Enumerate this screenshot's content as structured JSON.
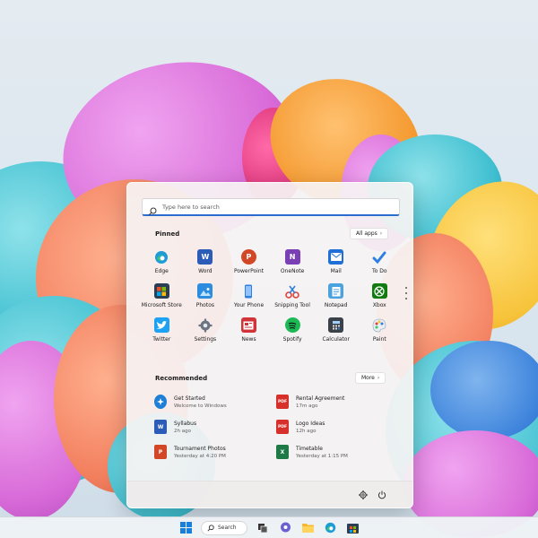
{
  "search": {
    "placeholder": "Type here to search"
  },
  "pinned": {
    "title": "Pinned",
    "all_apps_label": "All apps",
    "apps": [
      {
        "label": "Edge",
        "icon": "edge-icon"
      },
      {
        "label": "Word",
        "icon": "word-icon"
      },
      {
        "label": "PowerPoint",
        "icon": "powerpoint-icon"
      },
      {
        "label": "OneNote",
        "icon": "onenote-icon"
      },
      {
        "label": "Mail",
        "icon": "mail-icon"
      },
      {
        "label": "To Do",
        "icon": "todo-icon"
      },
      {
        "label": "Microsoft Store",
        "icon": "store-icon"
      },
      {
        "label": "Photos",
        "icon": "photos-icon"
      },
      {
        "label": "Your Phone",
        "icon": "phone-icon"
      },
      {
        "label": "Snipping Tool",
        "icon": "snipping-tool-icon"
      },
      {
        "label": "Notepad",
        "icon": "notepad-icon"
      },
      {
        "label": "Xbox",
        "icon": "xbox-icon"
      },
      {
        "label": "Twitter",
        "icon": "twitter-icon"
      },
      {
        "label": "Settings",
        "icon": "settings-icon"
      },
      {
        "label": "News",
        "icon": "news-icon"
      },
      {
        "label": "Spotify",
        "icon": "spotify-icon"
      },
      {
        "label": "Calculator",
        "icon": "calculator-icon"
      },
      {
        "label": "Paint",
        "icon": "paint-icon"
      }
    ]
  },
  "recommended": {
    "title": "Recommended",
    "more_label": "More",
    "items": [
      {
        "name": "Get Started",
        "sub": "Welcome to Windows",
        "icon": "get-started-icon"
      },
      {
        "name": "Rental Agreement",
        "sub": "17m ago",
        "icon": "pdf-file-icon"
      },
      {
        "name": "Syllabus",
        "sub": "2h ago",
        "icon": "word-file-icon"
      },
      {
        "name": "Logo Ideas",
        "sub": "12h ago",
        "icon": "pdf-file-icon"
      },
      {
        "name": "Tournament Photos",
        "sub": "Yesterday at 4:20 PM",
        "icon": "powerpoint-file-icon"
      },
      {
        "name": "Timetable",
        "sub": "Yesterday at 1:15 PM",
        "icon": "excel-file-icon"
      }
    ]
  },
  "taskbar": {
    "search_label": "Search"
  },
  "colors": {
    "accent": "#2b6dcf",
    "menu_bg": "#f6f3f3"
  }
}
